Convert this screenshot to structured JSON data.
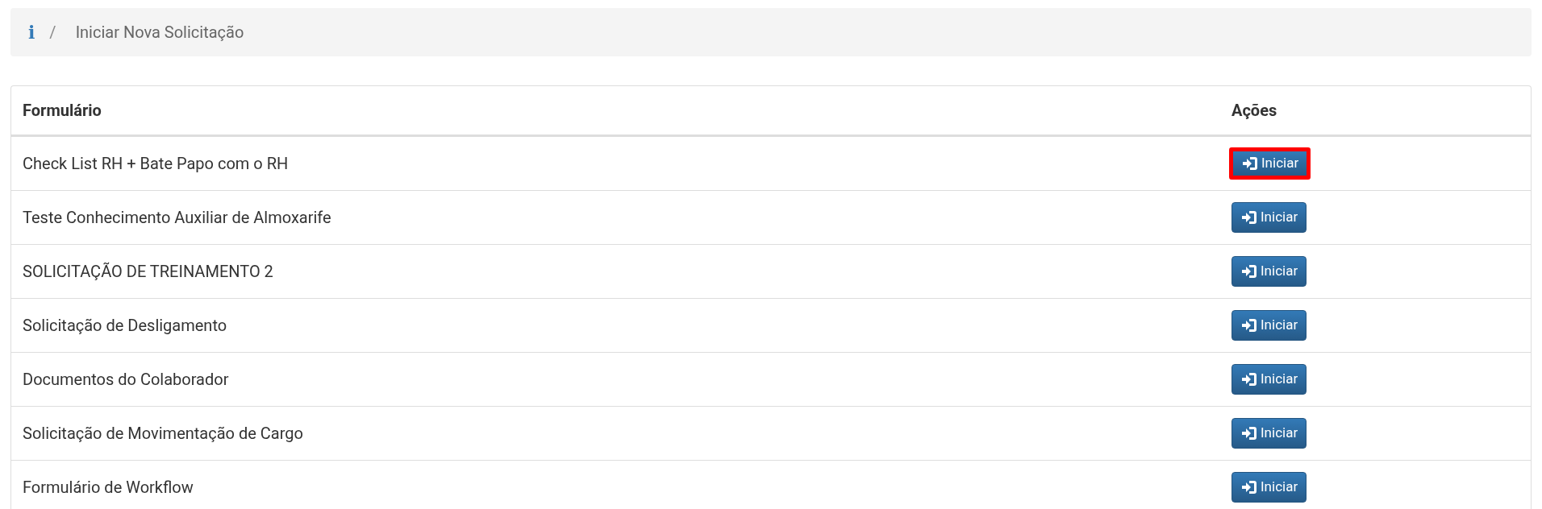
{
  "breadcrumb": {
    "icon": "i",
    "separator": "/",
    "current": "Iniciar Nova Solicitação"
  },
  "table": {
    "columns": [
      "Formulário",
      "Ações"
    ],
    "rows": [
      {
        "form": "Check List RH + Bate Papo com o RH",
        "action": "Iniciar",
        "highlighted": true
      },
      {
        "form": "Teste Conhecimento Auxiliar de Almoxarife",
        "action": "Iniciar",
        "highlighted": false
      },
      {
        "form": "SOLICITAÇÃO DE TREINAMENTO 2",
        "action": "Iniciar",
        "highlighted": false
      },
      {
        "form": "Solicitação de Desligamento",
        "action": "Iniciar",
        "highlighted": false
      },
      {
        "form": "Documentos do Colaborador",
        "action": "Iniciar",
        "highlighted": false
      },
      {
        "form": "Solicitação de Movimentação de Cargo",
        "action": "Iniciar",
        "highlighted": false
      },
      {
        "form": "Formulário de Workflow",
        "action": "Iniciar",
        "highlighted": false
      }
    ]
  }
}
